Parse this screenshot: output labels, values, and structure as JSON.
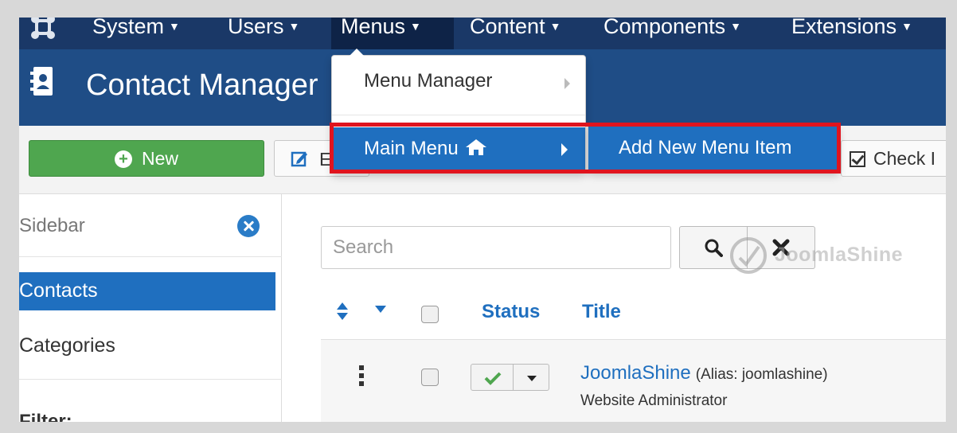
{
  "topnav": {
    "logo_icon": "joomla-logo-icon",
    "items": [
      {
        "label": "System"
      },
      {
        "label": "Users"
      },
      {
        "label": "Menus"
      },
      {
        "label": "Content"
      },
      {
        "label": "Components"
      },
      {
        "label": "Extensions"
      }
    ]
  },
  "header": {
    "title_icon": "address-book-icon",
    "title": "Contact Manager"
  },
  "toolbar": {
    "new_label": "New",
    "edit_label_visible": "E",
    "checkin_label_visible": "Check I"
  },
  "menus_dropdown": {
    "items": [
      {
        "label": "Menu Manager"
      },
      {
        "label": "Main Menu",
        "icon": "home-icon"
      }
    ],
    "submenu": {
      "label": "Add New Menu Item"
    }
  },
  "sidebar": {
    "title": "Sidebar",
    "items": [
      {
        "label": "Contacts",
        "active": true
      },
      {
        "label": "Categories",
        "active": false
      }
    ],
    "filter_label": "Filter:"
  },
  "search": {
    "placeholder": "Search"
  },
  "table": {
    "columns": {
      "status": "Status",
      "title": "Title"
    },
    "rows": [
      {
        "title": "JoomlaShine",
        "alias": "(Alias: joomlashine)",
        "access": "Website Administrator",
        "published": true
      }
    ]
  },
  "watermark": {
    "text": "JoomlaShine"
  },
  "colors": {
    "nav_bg": "#1a3867",
    "header_bg": "#1f4d86",
    "accent": "#1f6fbf",
    "new_button": "#4fa64f",
    "highlight_border": "#e0141e"
  }
}
